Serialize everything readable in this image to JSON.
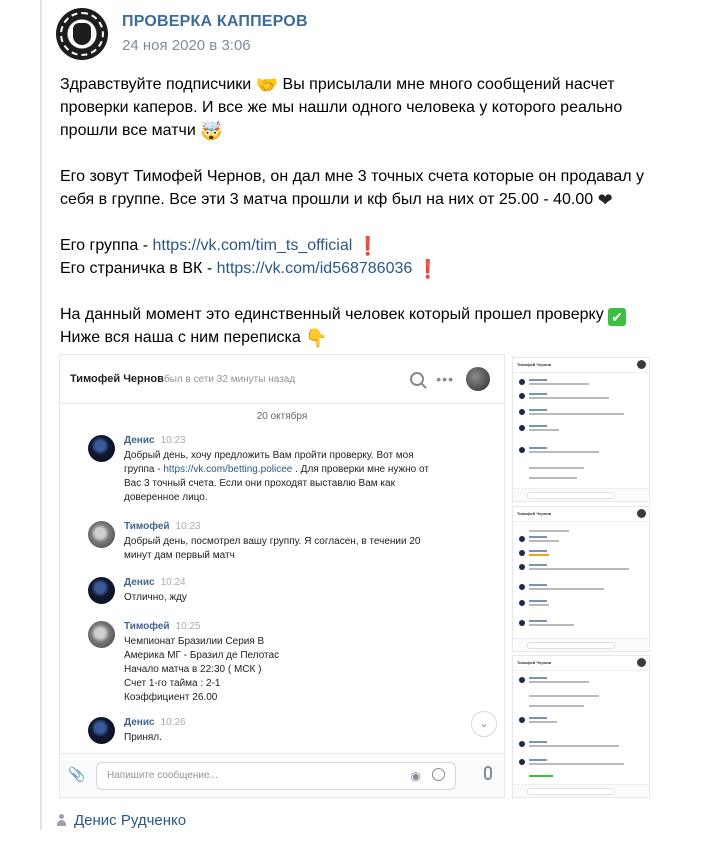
{
  "post": {
    "group_name": "ПРОВЕРКА КАППЕРОВ",
    "date": "24 ноя 2020 в 3:06",
    "greeting": "Здравствуйте подписчики",
    "para1_rest": "Вы присылали мне много сообщений насчет проверки каперов. И все же мы нашли одного человека у которого реально прошли все матчи",
    "para2": "Его зовут Тимофей Чернов, он дал мне 3 точных счета которые он продавал у себя в группе. Все эти 3 матча прошли и кф был на них от 25.00 - 40.00",
    "group_label": "Его группа - ",
    "group_link": "https://vk.com/tim_ts_official",
    "page_label": "Его страничка в ВК - ",
    "page_link": "https://vk.com/id568786036",
    "para4_line1": "На данный момент это единственный человек который прошел проверку",
    "para4_line2": "Ниже вся наша с ним переписка",
    "emojis": {
      "handshake": "🤝",
      "shocked": "🤯",
      "heart": "❤",
      "exclamation": "❗",
      "check": "✔",
      "point_down": "👇"
    },
    "author": "Денис Рудченко"
  },
  "chat": {
    "contact_name": "Тимофей Чернов",
    "status": "был в сети 32 минуты назад",
    "date_separator": "20 октября",
    "messages": [
      {
        "author": "Денис",
        "time": "10:23",
        "text_before_link": "Добрый день, хочу предложить Вам пройти проверку. Вот моя группа - ",
        "link": "https://vk.com/betting.policee",
        "text_after_link": " . Для проверки мне нужно от Вас 3 точный счета. Если они проходят выставлю Вам как доверенное лицо."
      },
      {
        "author": "Тимофей",
        "time": "10:23",
        "text": "Добрый день, посмотрел вашу группу. Я согласен, в течении 20 минут дам первый матч"
      },
      {
        "author": "Денис",
        "time": "10:24",
        "text": "Отлично, жду"
      },
      {
        "author": "Тимофей",
        "time": "10:25",
        "text": "Чемпионат Бразилии Серия B\nАмерика МГ - Бразил де Пелотас\nНачало матча в 22:30 ( МСК )\nСчет 1-го тайма : 2-1\nКоэффициент 26.00"
      },
      {
        "author": "Денис",
        "time": "10:26",
        "text": "Принял."
      }
    ],
    "input_placeholder": "Напишите сообщение..."
  },
  "thumbnails": {
    "contact_name": "Тимофей Чернов"
  },
  "colors": {
    "link": "#2a5885",
    "group_name": "#3d6c98",
    "meta": "#818c99",
    "check": "#3ac040"
  }
}
